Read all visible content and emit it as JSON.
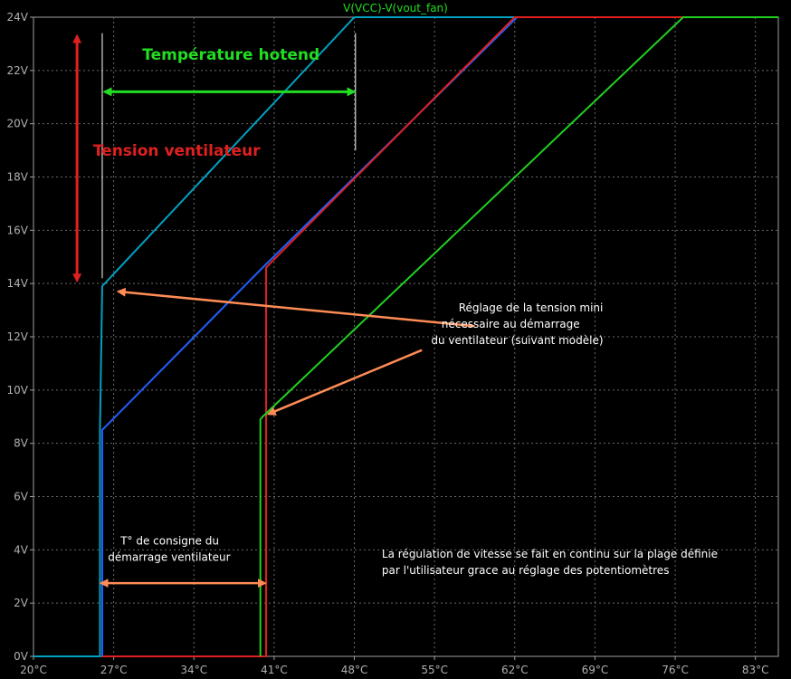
{
  "chart_data": {
    "type": "line",
    "title": "V(VCC)-V(vout_fan)",
    "xlim": [
      20,
      85
    ],
    "ylim": [
      0,
      24
    ],
    "x_ticks": [
      "20°C",
      "27°C",
      "34°C",
      "41°C",
      "48°C",
      "55°C",
      "62°C",
      "69°C",
      "76°C",
      "83°C"
    ],
    "x_tick_values": [
      20,
      27,
      34,
      41,
      48,
      55,
      62,
      69,
      76,
      83
    ],
    "y_ticks": [
      "0V",
      "2V",
      "4V",
      "6V",
      "8V",
      "10V",
      "12V",
      "14V",
      "16V",
      "18V",
      "20V",
      "22V",
      "24V"
    ],
    "y_tick_values": [
      0,
      2,
      4,
      6,
      8,
      10,
      12,
      14,
      16,
      18,
      20,
      22,
      24
    ],
    "grid": true,
    "series": [
      {
        "color": "#00a0c0",
        "x": [
          20,
          25.8,
          25.8,
          26.0,
          48.0,
          85
        ],
        "y": [
          0,
          0,
          8.5,
          13.9,
          24,
          24
        ]
      },
      {
        "color": "#2060ff",
        "x": [
          26.0,
          26.0,
          40.0,
          62.2,
          85
        ],
        "y": [
          0,
          8.5,
          14.6,
          24,
          24
        ]
      },
      {
        "color": "#e02020",
        "x": [
          26.0,
          40.0,
          40.3,
          40.3,
          62.0,
          85
        ],
        "y": [
          0,
          0,
          0,
          14.6,
          24,
          24
        ]
      },
      {
        "color": "#20d020",
        "x": [
          39.8,
          39.8,
          40.0,
          76.7,
          85
        ],
        "y": [
          0,
          8.9,
          9.0,
          24,
          24
        ]
      }
    ],
    "annotations": {
      "temp_label": "Température hotend",
      "volt_label": "Tension ventilateur",
      "min_voltage_note": [
        "Réglage de la tension mini",
        "nécessaire au démarrage",
        "du ventilateur (suivant modèle)"
      ],
      "setpoint_note": [
        "T° de consigne du",
        "démarrage ventilateur"
      ],
      "regulation_note": [
        "La régulation de vitesse se fait en continu sur la plage définie",
        "par l'utilisateur grace au réglage des potentiomètres"
      ]
    }
  }
}
